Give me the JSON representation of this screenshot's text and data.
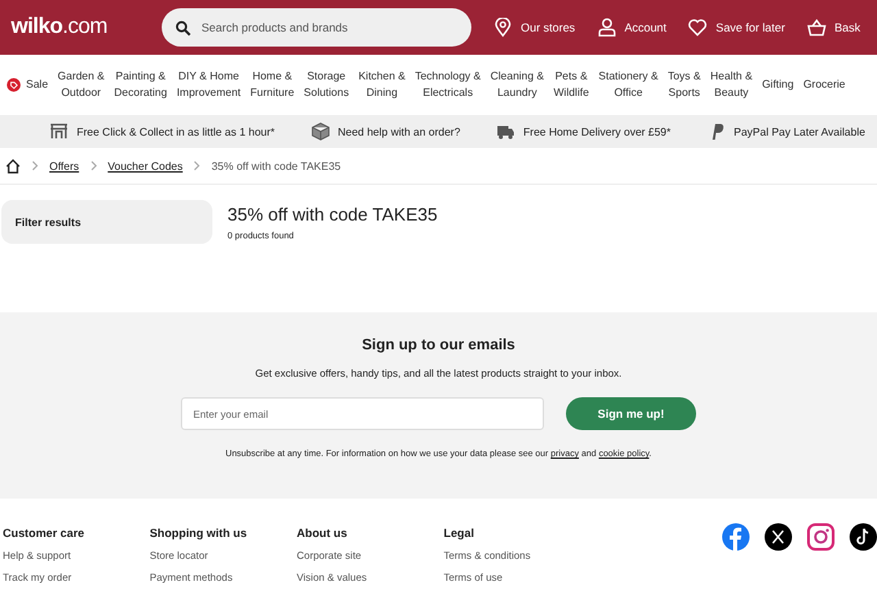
{
  "header": {
    "logo": "**wilko**.com",
    "search": {
      "placeholder": "Search products and brands"
    },
    "actions": [
      {
        "kind": "pin",
        "label": "Our stores"
      },
      {
        "kind": "person",
        "label": "Account"
      },
      {
        "kind": "heart",
        "label": "Save for later"
      },
      {
        "kind": "basket",
        "label": "Bask"
      }
    ]
  },
  "nav": {
    "items": [
      {
        "kind": "sale",
        "label": "Sale"
      },
      {
        "kind": "plain",
        "label": "Garden &\nOutdoor"
      },
      {
        "kind": "plain",
        "label": "Painting &\nDecorating"
      },
      {
        "kind": "plain",
        "label": "DIY & Home\nImprovement"
      },
      {
        "kind": "plain",
        "label": "Home &\nFurniture"
      },
      {
        "kind": "plain",
        "label": "Storage\nSolutions"
      },
      {
        "kind": "plain",
        "label": "Kitchen &\nDining"
      },
      {
        "kind": "plain",
        "label": "Technology &\nElectricals"
      },
      {
        "kind": "plain",
        "label": "Cleaning &\nLaundry"
      },
      {
        "kind": "plain",
        "label": "Pets &\nWildlife"
      },
      {
        "kind": "plain",
        "label": "Stationery &\nOffice"
      },
      {
        "kind": "plain",
        "label": "Toys &\nSports"
      },
      {
        "kind": "plain",
        "label": "Health &\nBeauty"
      },
      {
        "kind": "plain",
        "label": "Gifting"
      },
      {
        "kind": "plain",
        "label": "Grocerie"
      }
    ]
  },
  "usp_bar": {
    "items": [
      {
        "kind": "store",
        "label": "Free Click & Collect in as little as 1 hour*"
      },
      {
        "kind": "box",
        "label": "Need help with an order?"
      },
      {
        "kind": "truck",
        "label": "Free Home Delivery over £59*"
      },
      {
        "kind": "paypal",
        "label": "PayPal Pay Later Available"
      }
    ]
  },
  "breadcrumb": {
    "items": [
      {
        "kind": "link",
        "label": "Offers"
      },
      {
        "kind": "link",
        "label": "Voucher Codes"
      },
      {
        "kind": "current",
        "label": "35% off with code TAKE35"
      }
    ]
  },
  "filter": {
    "label": "Filter results"
  },
  "results": {
    "title": "35% off with code TAKE35",
    "count": "0 products found"
  },
  "signup": {
    "title": "Sign up to our emails",
    "text": "Get exclusive offers, handy tips, and all the latest products straight to your inbox.",
    "email": {
      "placeholder": "Enter your email"
    },
    "button": "Sign me up!",
    "note": {
      "before": "Unsubscribe at any time. For information on how we use your data please see our",
      "privacy_link": "privacy",
      "between": "and",
      "cookie_link": "cookie policy",
      "after": "."
    }
  },
  "footer": {
    "columns": [
      {
        "title": "Customer care",
        "links": [
          "Help & support",
          "Track my order"
        ]
      },
      {
        "title": "Shopping with us",
        "links": [
          "Store locator",
          "Payment methods"
        ]
      },
      {
        "title": "About us",
        "links": [
          "Corporate site",
          "Vision & values"
        ]
      },
      {
        "title": "Legal",
        "links": [
          "Terms & conditions",
          "Terms of use"
        ]
      }
    ],
    "social": [
      {
        "kind": "facebook"
      },
      {
        "kind": "x"
      },
      {
        "kind": "instagram"
      },
      {
        "kind": "tiktok"
      }
    ]
  }
}
